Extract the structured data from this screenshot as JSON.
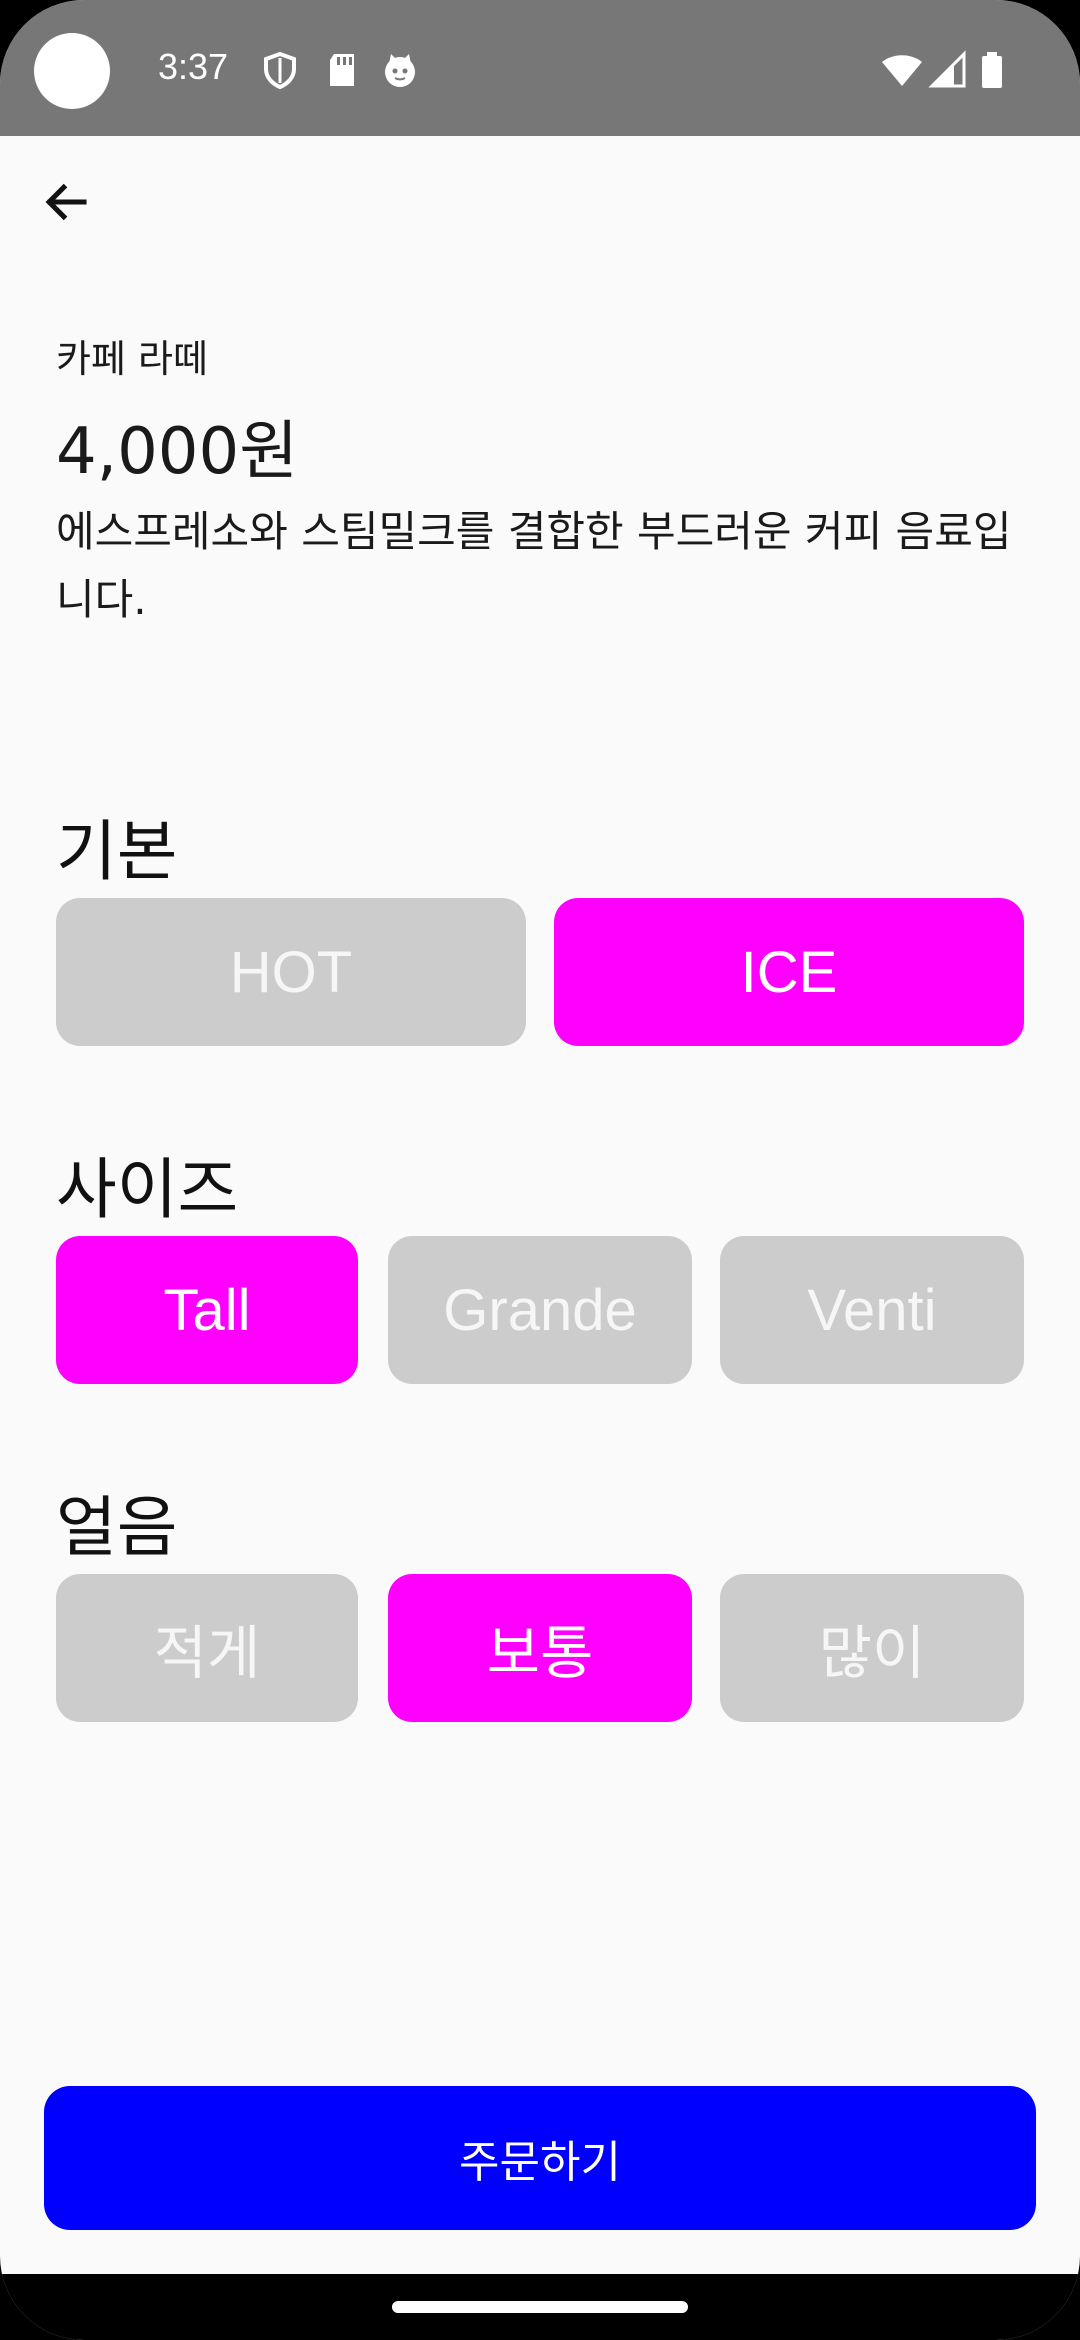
{
  "status_bar": {
    "time": "3:37",
    "icons": [
      "shield-icon",
      "sd-card-icon",
      "cat-face-icon",
      "wifi-icon",
      "signal-icon",
      "battery-icon"
    ]
  },
  "app_bar": {
    "back_icon": "arrow-left-icon"
  },
  "product": {
    "name": "카페 라떼",
    "price": "4,000원",
    "description": "에스프레소와 스팀밀크를 결합한 부드러운 커피 음료입니다."
  },
  "sections": {
    "basic": {
      "title": "기본",
      "options": [
        "HOT",
        "ICE"
      ],
      "selected": "ICE"
    },
    "size": {
      "title": "사이즈",
      "options": [
        "Tall",
        "Grande",
        "Venti"
      ],
      "selected": "Tall"
    },
    "ice": {
      "title": "얼음",
      "options": [
        "적게",
        "보통",
        "많이"
      ],
      "selected": "보통"
    }
  },
  "order_button": {
    "label": "주문하기"
  },
  "colors": {
    "selected": "#ff00ff",
    "unselected": "#cccccc",
    "primary": "#0000ff",
    "status_bar": "#777777"
  }
}
